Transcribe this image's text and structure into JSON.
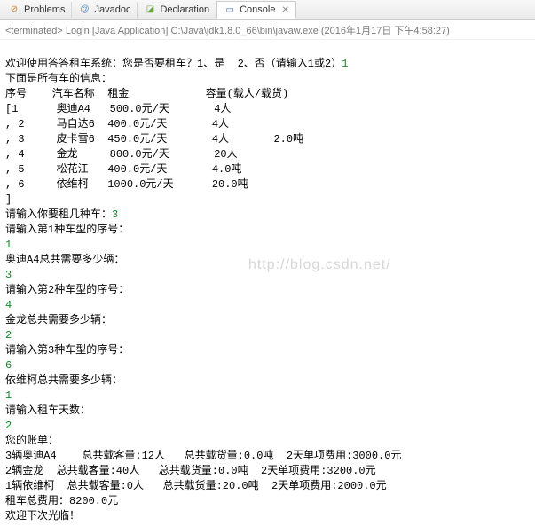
{
  "tabs": {
    "problems": "Problems",
    "javadoc": "Javadoc",
    "declaration": "Declaration",
    "console": "Console"
  },
  "terminated": "<terminated> Login [Java Application] C:\\Java\\jdk1.8.0_66\\bin\\javaw.exe (2016年1月17日 下午4:58:27)",
  "lines": {
    "l1a": "欢迎使用答答租车系统：您是否要租车？1、是  2、否（请输入1或2）",
    "l1b": "1",
    "l2": "下面是所有车的信息：",
    "l3": "序号    汽车名称  租金            容量(载人/载货)",
    "l4": "[1      奥迪A4   500.0元/天       4人",
    "l5": ", 2     马自达6  400.0元/天       4人",
    "l6": ", 3     皮卡雪6  450.0元/天       4人       2.0吨",
    "l7": ", 4     金龙     800.0元/天       20人",
    "l8": ", 5     松花江   400.0元/天       4.0吨",
    "l9": ", 6     依维柯   1000.0元/天      20.0吨",
    "l10": "]",
    "l11a": "请输入你要租几种车：",
    "l11b": "3",
    "l12": "请输入第1种车型的序号：",
    "l13": "1",
    "l14": "奥迪A4总共需要多少辆：",
    "l15": "3",
    "l16": "请输入第2种车型的序号：",
    "l17": "4",
    "l18": "金龙总共需要多少辆：",
    "l19": "2",
    "l20": "请输入第3种车型的序号：",
    "l21": "6",
    "l22": "依维柯总共需要多少辆：",
    "l23": "1",
    "l24": "请输入租车天数：",
    "l25": "2",
    "l26": "您的账单：",
    "l27": "3辆奥迪A4    总共载客量:12人   总共载货量:0.0吨  2天单项费用:3000.0元",
    "l28": "2辆金龙  总共载客量:40人   总共载货量:0.0吨  2天单项费用:3200.0元",
    "l29": "1辆依维柯  总共载客量:0人   总共载货量:20.0吨  2天单项费用:2000.0元",
    "l30": "租车总费用：8200.0元",
    "l31": "欢迎下次光临！"
  },
  "watermark": "http://blog.csdn.net/",
  "chart_data": {
    "type": "table",
    "title": "所有车的信息",
    "columns": [
      "序号",
      "汽车名称",
      "租金(元/天)",
      "载人(人)",
      "载货(吨)"
    ],
    "rows": [
      [
        1,
        "奥迪A4",
        500.0,
        4,
        null
      ],
      [
        2,
        "马自达6",
        400.0,
        4,
        null
      ],
      [
        3,
        "皮卡雪6",
        450.0,
        4,
        2.0
      ],
      [
        4,
        "金龙",
        800.0,
        20,
        null
      ],
      [
        5,
        "松花江",
        400.0,
        null,
        4.0
      ],
      [
        6,
        "依维柯",
        1000.0,
        null,
        20.0
      ]
    ],
    "bill": {
      "days": 2,
      "items": [
        {
          "car": "奥迪A4",
          "qty": 3,
          "passengers": 12,
          "cargo_t": 0.0,
          "cost": 3000.0
        },
        {
          "car": "金龙",
          "qty": 2,
          "passengers": 40,
          "cargo_t": 0.0,
          "cost": 3200.0
        },
        {
          "car": "依维柯",
          "qty": 1,
          "passengers": 0,
          "cargo_t": 20.0,
          "cost": 2000.0
        }
      ],
      "total": 8200.0
    }
  }
}
